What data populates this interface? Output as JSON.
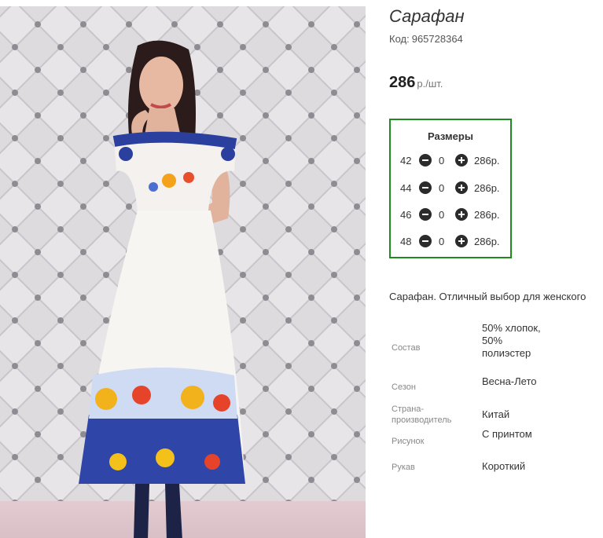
{
  "product": {
    "title": "Сарафан",
    "code_label": "Код:",
    "code_value": "965728364",
    "price_value": "286",
    "price_unit": "р./шт."
  },
  "sizes": {
    "title": "Размеры",
    "rows": [
      {
        "size": "42",
        "qty": "0",
        "price": "286р."
      },
      {
        "size": "44",
        "qty": "0",
        "price": "286р."
      },
      {
        "size": "46",
        "qty": "0",
        "price": "286р."
      },
      {
        "size": "48",
        "qty": "0",
        "price": "286р."
      }
    ]
  },
  "description": "Сарафан. Отличный выбор для женского",
  "specs": [
    {
      "name": "Состав",
      "value": "50% хлопок, 50% полиэстер"
    },
    {
      "name": "Сезон",
      "value": "Весна-Лето"
    },
    {
      "name": "Страна-производитель",
      "value": "Китай"
    },
    {
      "name": "Рисунок",
      "value": "С принтом"
    },
    {
      "name": "Рукав",
      "value": "Короткий"
    }
  ],
  "icons": {
    "minus": "minus-circle-icon",
    "plus": "plus-circle-icon"
  },
  "colors": {
    "sizes_border": "#1f8a1f",
    "button": "#2b2b2b"
  }
}
